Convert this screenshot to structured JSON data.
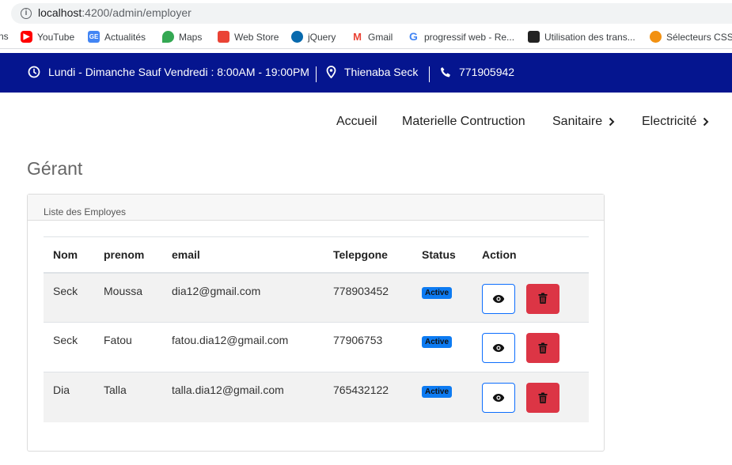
{
  "browser": {
    "url_host": "localhost",
    "url_path": ":4200/admin/employer",
    "bookmarks": [
      "ns",
      "YouTube",
      "Actualités",
      "Maps",
      "Web Store",
      "jQuery",
      "Gmail",
      "progressif web - Re...",
      "Utilisation des trans...",
      "Sélecteurs CSS"
    ]
  },
  "topbar": {
    "hours": "Lundi - Dimanche Sauf Vendredi : 8:00AM - 19:00PM",
    "location": "Thienaba Seck",
    "phone": "771905942"
  },
  "nav": {
    "items": [
      "Accueil",
      "Materielle Contruction",
      "Sanitaire",
      "Electricité"
    ]
  },
  "page": {
    "title": "Gérant",
    "card_title": "Liste des Employes"
  },
  "table": {
    "headers": [
      "Nom",
      "prenom",
      "email",
      "Telepgone",
      "Status",
      "Action"
    ],
    "rows": [
      {
        "nom": "Seck",
        "prenom": "Moussa",
        "email": "dia12@gmail.com",
        "tel": "778903452",
        "status": "Active"
      },
      {
        "nom": "Seck",
        "prenom": "Fatou",
        "email": "fatou.dia12@gmail.com",
        "tel": "77906753",
        "status": "Active"
      },
      {
        "nom": "Dia",
        "prenom": "Talla",
        "email": "talla.dia12@gmail.com",
        "tel": "765432122",
        "status": "Active"
      }
    ]
  },
  "colors": {
    "topbar_bg": "#05158f",
    "badge": "#0d7bf2",
    "delete": "#dc3545",
    "view_border": "#0d6efd"
  },
  "icons": {
    "clock": "clock-icon",
    "location": "map-pin-icon",
    "phone": "phone-icon",
    "view": "eye-icon",
    "delete": "trash-icon",
    "chevron": "chevron-right-icon"
  }
}
